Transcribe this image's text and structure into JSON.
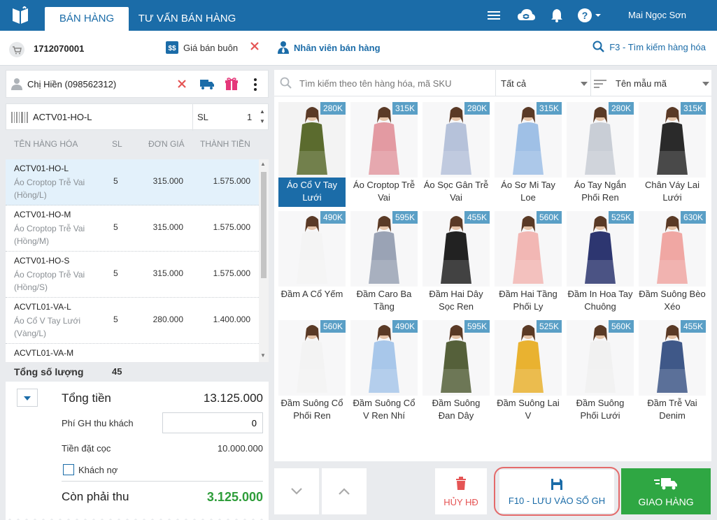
{
  "tabs": {
    "sales": "BÁN HÀNG",
    "consult": "TƯ VẤN BÁN HÀNG"
  },
  "user": {
    "name": "Mai Ngọc Sơn"
  },
  "order": {
    "id": "1712070001",
    "wholesale_label": "Giá bán buôn",
    "staff_label": "Nhân viên bán hàng",
    "search_hint": "F3 - Tìm kiếm hàng hóa"
  },
  "customer": {
    "name": "Chị Hiền (098562312)"
  },
  "sku_entry": {
    "code": "ACTV01-HO-L",
    "qty_label": "SL",
    "qty": "1"
  },
  "table": {
    "headers": {
      "name": "TÊN HÀNG HÓA",
      "qty": "SL",
      "price": "ĐƠN GIÁ",
      "total": "THÀNH TIỀN"
    },
    "rows": [
      {
        "code": "ACTV01-HO-L",
        "name": "Áo Croptop Trễ Vai (Hồng/L)",
        "qty": "5",
        "price": "315.000",
        "total": "1.575.000"
      },
      {
        "code": "ACTV01-HO-M",
        "name": "Áo Croptop Trễ Vai (Hồng/M)",
        "qty": "5",
        "price": "315.000",
        "total": "1.575.000"
      },
      {
        "code": "ACTV01-HO-S",
        "name": "Áo Croptop Trễ Vai (Hồng/S)",
        "qty": "5",
        "price": "315.000",
        "total": "1.575.000"
      },
      {
        "code": "ACVTL01-VA-L",
        "name": "Áo Cổ V Tay Lưới (Vàng/L)",
        "qty": "5",
        "price": "280.000",
        "total": "1.400.000"
      },
      {
        "code": "ACVTL01-VA-M",
        "name": "",
        "qty": "",
        "price": "",
        "total": ""
      }
    ]
  },
  "totals": {
    "qty_label": "Tổng số lượng",
    "qty_value": "45",
    "total_label": "Tổng tiền",
    "total_value": "13.125.000",
    "ship_label": "Phí GH thu khách",
    "ship_value": "0",
    "deposit_label": "Tiền đặt cọc",
    "deposit_value": "10.000.000",
    "debt_label": "Khách nợ",
    "due_label": "Còn phải thu",
    "due_value": "3.125.000"
  },
  "product_search": {
    "placeholder": "Tìm kiếm theo tên hàng hóa, mã SKU",
    "filter_all": "Tất cả",
    "sort_label": "Tên mẫu mã"
  },
  "products": [
    {
      "price": "280K",
      "name": "Áo Cổ V Tay Lưới",
      "color": "#5b6b2e"
    },
    {
      "price": "315K",
      "name": "Áo Croptop Trễ Vai",
      "color": "#e39aa2"
    },
    {
      "price": "280K",
      "name": "Áo Sọc Gân Trễ Vai",
      "color": "#b6c2da"
    },
    {
      "price": "315K",
      "name": "Áo Sơ Mi Tay Loe",
      "color": "#9fc0e6"
    },
    {
      "price": "280K",
      "name": "Áo Tay Ngắn Phối Ren",
      "color": "#c9ced6"
    },
    {
      "price": "315K",
      "name": "Chân Váy Lai Lưới",
      "color": "#2a2a2a"
    },
    {
      "price": "490K",
      "name": "Đầm A Cổ Yếm",
      "color": "#f4f4f4"
    },
    {
      "price": "595K",
      "name": "Đầm Caro Ba Tầng",
      "color": "#9aa3b5"
    },
    {
      "price": "455K",
      "name": "Đầm Hai Dây Sọc Ren",
      "color": "#222222"
    },
    {
      "price": "560K",
      "name": "Đầm Hai Tầng Phối Ly",
      "color": "#f2b7b4"
    },
    {
      "price": "525K",
      "name": "Đầm In Hoa Tay Chuông",
      "color": "#2d3670"
    },
    {
      "price": "630K",
      "name": "Đầm Suông Bèo Xéo",
      "color": "#f0a7a3"
    },
    {
      "price": "560K",
      "name": "Đầm Suông Cổ Phối Ren",
      "color": "#f3f3f3"
    },
    {
      "price": "490K",
      "name": "Đầm Suông Cổ V Ren Nhí",
      "color": "#a8c7ea"
    },
    {
      "price": "595K",
      "name": "Đầm Suông Đan Dây",
      "color": "#55603a"
    },
    {
      "price": "525K",
      "name": "Đầm Suông Lai V",
      "color": "#e9b230"
    },
    {
      "price": "560K",
      "name": "Đầm Suông Phối Lưới",
      "color": "#f1f1f1"
    },
    {
      "price": "455K",
      "name": "Đầm Trễ Vai Denim",
      "color": "#3f5888"
    }
  ],
  "actions": {
    "cancel": "HỦY HĐ",
    "save": "F10 - LƯU VÀO SỔ GH",
    "deliver": "GIAO HÀNG"
  },
  "colors": {
    "brand": "#1b6ca8",
    "green": "#2fa743",
    "red": "#e55454"
  }
}
